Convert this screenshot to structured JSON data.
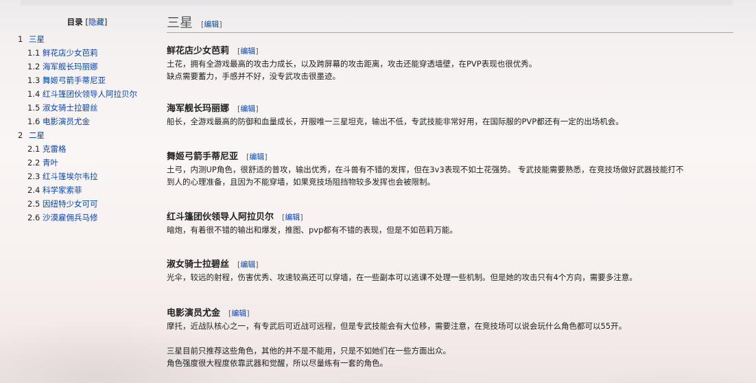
{
  "toc": {
    "title": "目录",
    "toggle_label": "隐藏",
    "items": [
      {
        "num": "1",
        "label": "三星",
        "level": 1
      },
      {
        "num": "1.1",
        "label": "鲜花店少女芭莉",
        "level": 2
      },
      {
        "num": "1.2",
        "label": "海军舰长玛丽娜",
        "level": 2
      },
      {
        "num": "1.3",
        "label": "舞姬弓箭手蒂尼亚",
        "level": 2
      },
      {
        "num": "1.4",
        "label": "红斗篷团伙领导人阿拉贝尔",
        "level": 2
      },
      {
        "num": "1.5",
        "label": "淑女骑士拉碧丝",
        "level": 2
      },
      {
        "num": "1.6",
        "label": "电影演员尤金",
        "level": 2
      },
      {
        "num": "2",
        "label": "二星",
        "level": 1
      },
      {
        "num": "2.1",
        "label": "克雷格",
        "level": 2
      },
      {
        "num": "2.2",
        "label": "青叶",
        "level": 2
      },
      {
        "num": "2.3",
        "label": "红斗篷埃尔韦拉",
        "level": 2
      },
      {
        "num": "2.4",
        "label": "科学家索菲",
        "level": 2
      },
      {
        "num": "2.5",
        "label": "因纽特少女可可",
        "level": 2
      },
      {
        "num": "2.6",
        "label": "沙漠雇佣兵马修",
        "level": 2
      }
    ]
  },
  "section": {
    "title": "三星",
    "edit_label": "编辑"
  },
  "entries": [
    {
      "title": "鲜花店少女芭莉",
      "edit_label": "编辑",
      "lines": [
        "土花，拥有全游戏最高的攻击力成长，以及跨屏幕的攻击距离，攻击还能穿透墙壁，在PVP表现也很优秀。",
        "缺点需要蓄力，手感并不好，没专武攻击很墨迹。"
      ]
    },
    {
      "title": "海军舰长玛丽娜",
      "edit_label": "编辑",
      "lines": [
        "船长，全游戏最高的防御和血量成长，开服唯一三星坦克，输出不低，专武技能非常好用，在国际服的PVP都还有一定的出场机会。"
      ]
    },
    {
      "title": "舞姬弓箭手蒂尼亚",
      "edit_label": "编辑",
      "lines": [
        "土弓，内测UP角色，很舒适的普攻，输出优秀，在斗兽有不错的发挥，但在3v3表现不如土花强势。 专武技能需要熟悉，在竞技场做好武器技能打不",
        "到人的心理准备，且因为不能穿墙，如果竞技场阻挡物较多发挥也会被限制。"
      ]
    },
    {
      "title": "红斗篷团伙领导人阿拉贝尔",
      "edit_label": "编辑",
      "lines": [
        "暗炮，有着很不错的输出和爆发，推图、pvp都有不错的表现，但是不如芭莉万能。"
      ]
    },
    {
      "title": "淑女骑士拉碧丝",
      "edit_label": "编辑",
      "lines": [
        "光伞，较远的射程，伤害优秀、攻速较高还可以穿墙，在一些副本可以逃课不处理一些机制。但是她的攻击只有4个方向，需要多注意。"
      ]
    },
    {
      "title": "电影演员尤金",
      "edit_label": "编辑",
      "lines": [
        "摩托，近战队核心之一，有专武后可近战可远程，但是专武技能会有大位移，需要注意，在竞技场可以说会玩什么角色都可以55开。"
      ]
    }
  ],
  "notes": [
    "三星目前只推荐这些角色，其他的并不是不能用，只是不如她们在一些方面出众。",
    "角色强度很大程度依靠武器和觉醒，所以尽量练有一套的角色。"
  ]
}
